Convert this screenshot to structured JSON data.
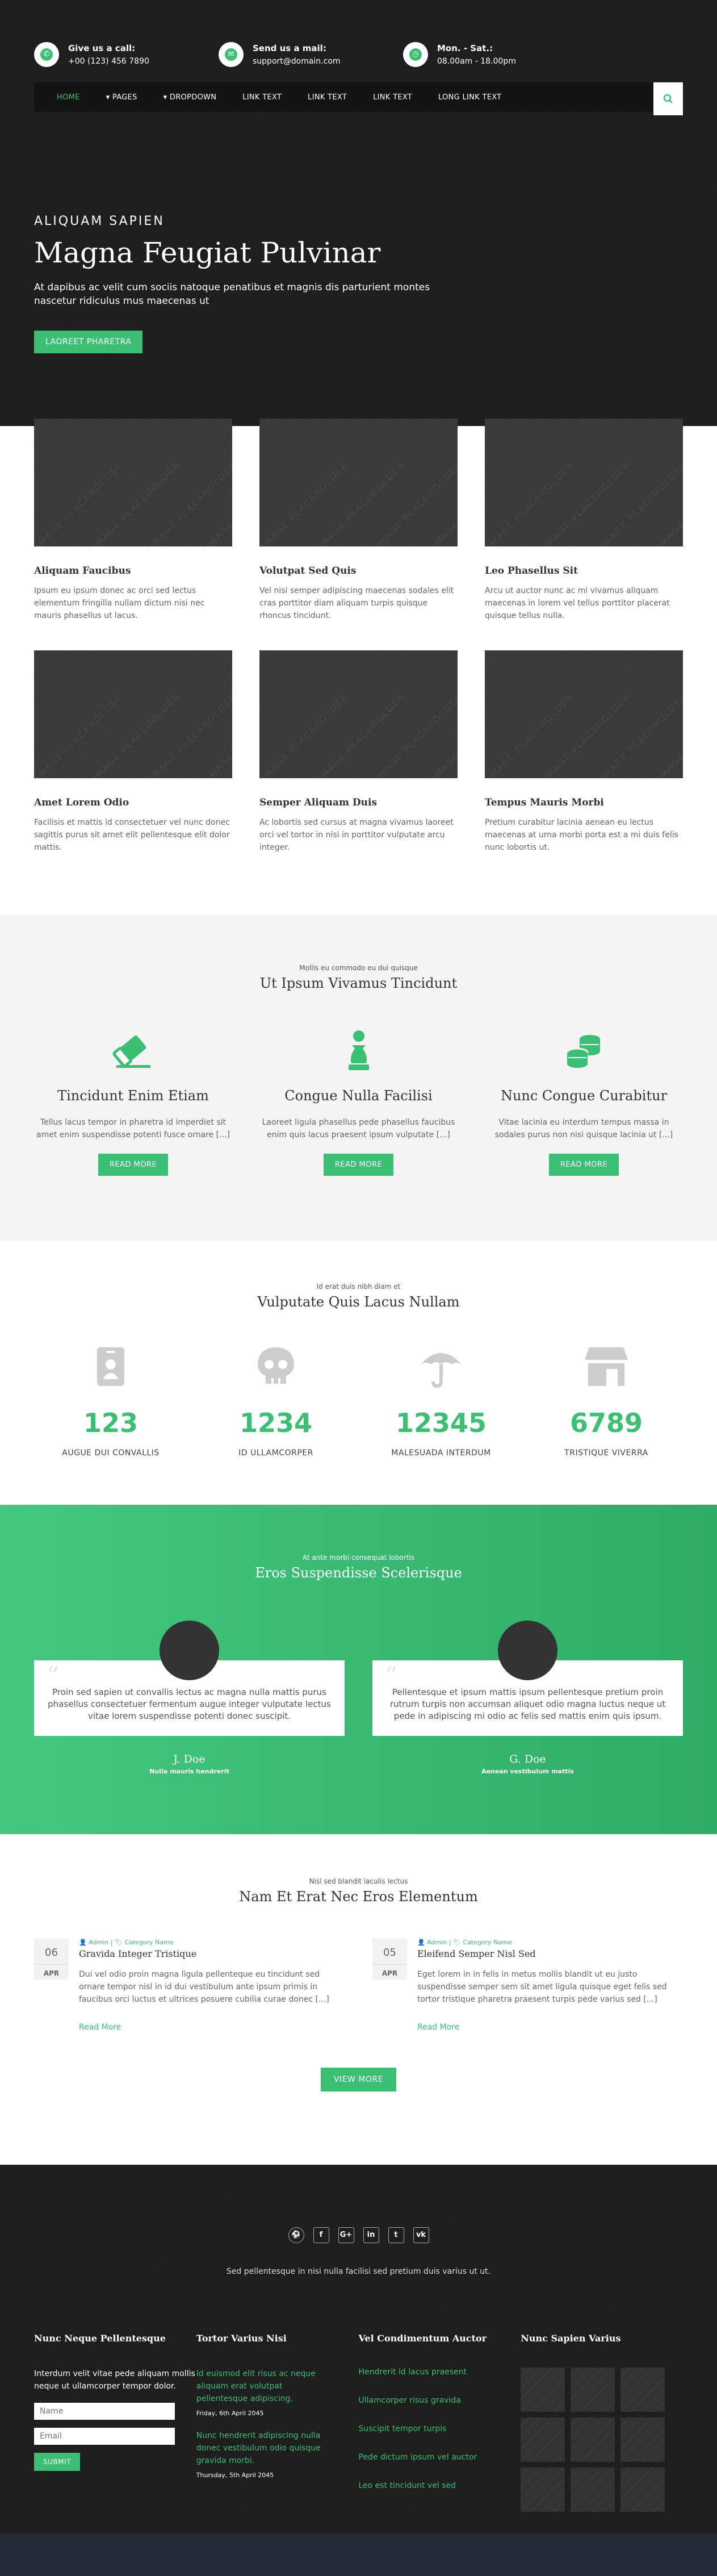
{
  "topbar": {
    "call": {
      "title": "Give us a call:",
      "value": "+00 (123) 456 7890"
    },
    "mail": {
      "title": "Send us a mail:",
      "value": "support@domain.com"
    },
    "hours": {
      "title": "Mon. - Sat.:",
      "value": "08.00am - 18.00pm"
    }
  },
  "nav": {
    "items": [
      "HOME",
      "PAGES",
      "DROPDOWN",
      "LINK TEXT",
      "LINK TEXT",
      "LINK TEXT",
      "LONG LINK TEXT"
    ],
    "search_icon": "search-icon"
  },
  "hero": {
    "kicker": "ALIQUAM SAPIEN",
    "title": "Magna Feugiat Pulvinar",
    "text": "At dapibus ac velit cum sociis natoque penatibus et magnis dis parturient montes nascetur ridiculus mus maecenas ut",
    "button": "LAOREET PHARETRA"
  },
  "placeholder_text": "IMAGE PLACEHOLDER",
  "features": [
    {
      "title": "Aliquam Faucibus",
      "text": "Ipsum eu ipsum donec ac orci sed lectus elementum fringilla nullam dictum nisi nec mauris phasellus ut lacus."
    },
    {
      "title": "Volutpat Sed Quis",
      "text": "Vel nisi semper adipiscing maecenas sodales elit cras porttitor diam aliquam turpis quisque rhoncus tincidunt."
    },
    {
      "title": "Leo Phasellus Sit",
      "text": "Arcu ut auctor nunc ac mi vivamus aliquam maecenas in lorem vel tellus porttitor placerat quisque tellus nulla."
    },
    {
      "title": "Amet Lorem Odio",
      "text": "Facilisis et mattis id consectetuer vel nunc donec sagittis purus sit amet elit pellentesque elit dolor mattis."
    },
    {
      "title": "Semper Aliquam Duis",
      "text": "Ac lobortis sed cursus at magna vivamus laoreet orci vel tortor in nisi in porttitor vulputate arcu integer."
    },
    {
      "title": "Tempus Mauris Morbi",
      "text": "Pretium curabitur lacinia aenean eu lectus maecenas at urna morbi porta est a mi duis felis nunc lobortis ut."
    }
  ],
  "services": {
    "kicker": "Mollis eu commodo eu dui quisque",
    "title": "Ut Ipsum Vivamus Tincidunt",
    "items": [
      {
        "icon": "eraser-icon",
        "title": "Tincidunt Enim Etiam",
        "text": "Tellus lacus tempor in pharetra id imperdiet sit amet enim suspendisse potenti fusce ornare [...]",
        "button": "READ MORE"
      },
      {
        "icon": "chess-pawn-icon",
        "title": "Congue Nulla Facilisi",
        "text": "Laoreet ligula phasellus pede phasellus faucibus enim quis lacus praesent ipsum vulputate [...]",
        "button": "READ MORE"
      },
      {
        "icon": "coins-icon",
        "title": "Nunc Congue Curabitur",
        "text": "Vitae lacinia eu interdum tempus massa in sodales purus non nisi quisque lacinia ut [...]",
        "button": "READ MORE"
      }
    ]
  },
  "stats": {
    "kicker": "Id erat duis nibh diam et",
    "title": "Vulputate Quis Lacus Nullam",
    "items": [
      {
        "icon": "id-badge-icon",
        "number": "123",
        "label": "AUGUE DUI CONVALLIS"
      },
      {
        "icon": "skull-icon",
        "number": "1234",
        "label": "ID ULLAMCORPER"
      },
      {
        "icon": "umbrella-icon",
        "number": "12345",
        "label": "MALESUADA INTERDUM"
      },
      {
        "icon": "store-icon",
        "number": "6789",
        "label": "TRISTIQUE VIVERRA"
      }
    ]
  },
  "testimonials": {
    "kicker": "At ante morbi consequat lobortis",
    "title": "Eros Suspendisse Scelerisque",
    "items": [
      {
        "text": "Proin sed sapien ut convallis lectus ac magna nulla mattis purus phasellus consectetuer fermentum augue integer vulputate lectus vitae lorem suspendisse potenti donec suscipit.",
        "name": "J. Doe",
        "role": "Nulla mauris hendrerit"
      },
      {
        "text": "Pellentesque et ipsum mattis ipsum pellentesque pretium proin rutrum turpis non accumsan aliquet odio magna luctus neque ut pede in adipiscing mi odio ac felis sed mattis enim quis ipsum.",
        "name": "G. Doe",
        "role": "Aenean vestibulum mattis"
      }
    ]
  },
  "blog": {
    "kicker": "Nisl sed blandit iaculis lectus",
    "title": "Nam Et Erat Nec Eros Elementum",
    "posts": [
      {
        "day": "06",
        "month": "APR",
        "author": "Admin",
        "category": "Category Name",
        "title": "Gravida Integer Tristique",
        "text": "Dui vel odio proin magna ligula pellenteque eu tincidunt sed ornare tempor nisl in id dui vestibulum ante ipsum primis in faucibus orci luctus et ultrices posuere cubilia curae donec [...]",
        "more": "Read More"
      },
      {
        "day": "05",
        "month": "APR",
        "author": "Admin",
        "category": "Category Name",
        "title": "Eleifend Semper Nisl Sed",
        "text": "Eget lorem in in felis in metus mollis blandit ut eu justo suspendisse semper sem sit amet ligula quisque eget felis sed tortor tristique pharetra praesent turpis pede varius sed [...]",
        "more": "Read More"
      }
    ],
    "button": "VIEW MORE"
  },
  "footer": {
    "social": [
      "dribbble-icon",
      "facebook-icon",
      "google-plus-icon",
      "linkedin-icon",
      "twitter-icon",
      "vk-icon"
    ],
    "social_glyphs": [
      "⚽",
      "f",
      "G+",
      "in",
      "t",
      "vk"
    ],
    "tagline": "Sed pellentesque in nisi nulla facilisi sed pretium duis varius ut ut.",
    "col1": {
      "title": "Nunc Neque Pellentesque",
      "text": "Interdum velit vitae pede aliquam mollis neque ut ullamcorper tempor dolor.",
      "name_ph": "Name",
      "email_ph": "Email",
      "button": "SUBMIT"
    },
    "col2": {
      "title": "Tortor Varius Nisi",
      "posts": [
        {
          "title": "Id euismod elit risus ac neque aliquam erat volutpat pellentesque adipiscing.",
          "date": "Friday, 6th April 2045"
        },
        {
          "title": "Nunc hendrerit adipiscing nulla donec vestibulum odio quisque gravida morbi.",
          "date": "Thursday, 5th April 2045"
        }
      ]
    },
    "col3": {
      "title": "Vel Condimentum Auctor",
      "links": [
        "Hendrerit id lacus praesent",
        "Ullamcorper risus gravida",
        "Suscipit tempor turpis",
        "Pede dictum ipsum vel auctor",
        "Leo est tincidunt vel sed"
      ]
    },
    "col4": {
      "title": "Nunc Sapien Varius"
    }
  }
}
